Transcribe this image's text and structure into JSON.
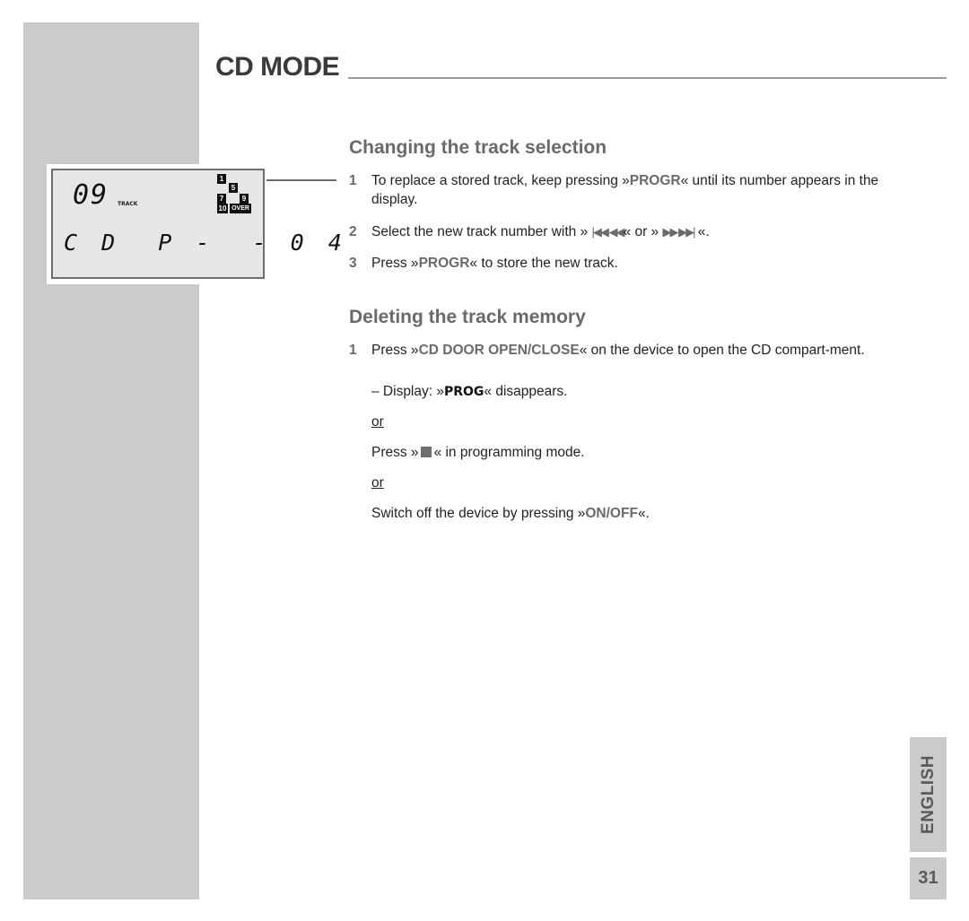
{
  "page": {
    "title": "CD MODE",
    "language_tab": "ENGLISH",
    "page_number": "31"
  },
  "lcd_display": {
    "track_number": "09",
    "track_label": "TRACK",
    "program_indicators": [
      "1",
      "5",
      "7",
      "9",
      "10",
      "OVER"
    ],
    "line2": "C D  P -  - 0 4"
  },
  "section_change": {
    "heading": "Changing the track selection",
    "steps": [
      {
        "num": "1",
        "pre": "To replace a stored track, keep pressing »",
        "kw": "PROGR",
        "post": "« until its number appears in the display."
      },
      {
        "num": "2",
        "pre": "Select the new track number with » ",
        "icon1": "|◀◀  ◀◀",
        "mid": "« or » ",
        "icon2": "▶▶  ▶▶|",
        "post": " «."
      },
      {
        "num": "3",
        "pre": "Press »",
        "kw": "PROGR",
        "post": "« to store the new track."
      }
    ]
  },
  "section_delete": {
    "heading": "Deleting the track memory",
    "step1": {
      "num": "1",
      "pre": "Press »",
      "kw": "CD DOOR OPEN/CLOSE",
      "post": "« on the device to open the CD compart-ment."
    },
    "display_note": {
      "pre": "– Display: »",
      "kw": "PROG",
      "post": "« disappears."
    },
    "or1": "or",
    "alt1": {
      "pre": "Press »",
      "icon": "stop-icon",
      "post": "« in programming mode."
    },
    "or2": "or",
    "alt2": {
      "pre": "Switch off the device by pressing »",
      "kw": "ON/OFF",
      "post": "«."
    }
  }
}
